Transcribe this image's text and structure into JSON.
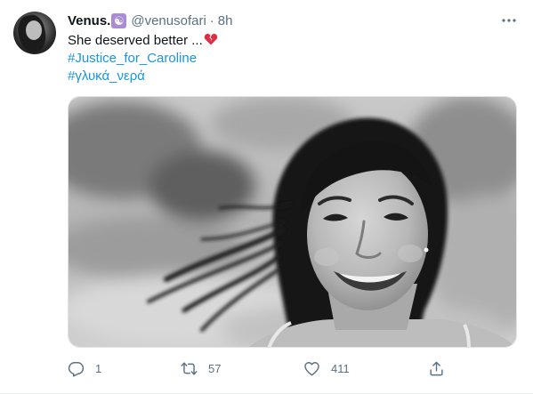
{
  "tweet": {
    "display_name": "Venus.",
    "name_emoji": "☯",
    "handle": "@venusofari",
    "separator": "·",
    "time": "8h",
    "text": "She deserved better ...",
    "hashtags": [
      "#Justice_for_Caroline",
      "#γλυκά_νερά"
    ]
  },
  "actions": {
    "replies": "1",
    "retweets": "57",
    "likes": "411"
  },
  "icons": {
    "avatar": "profile-avatar",
    "more": "more-dots-icon",
    "reply": "reply-icon",
    "retweet": "retweet-icon",
    "like": "heart-icon",
    "share": "share-icon",
    "emoji": "broken-heart-icon"
  },
  "colors": {
    "link": "#1b95e0",
    "muted": "#5b7083",
    "text": "#0f1419"
  }
}
